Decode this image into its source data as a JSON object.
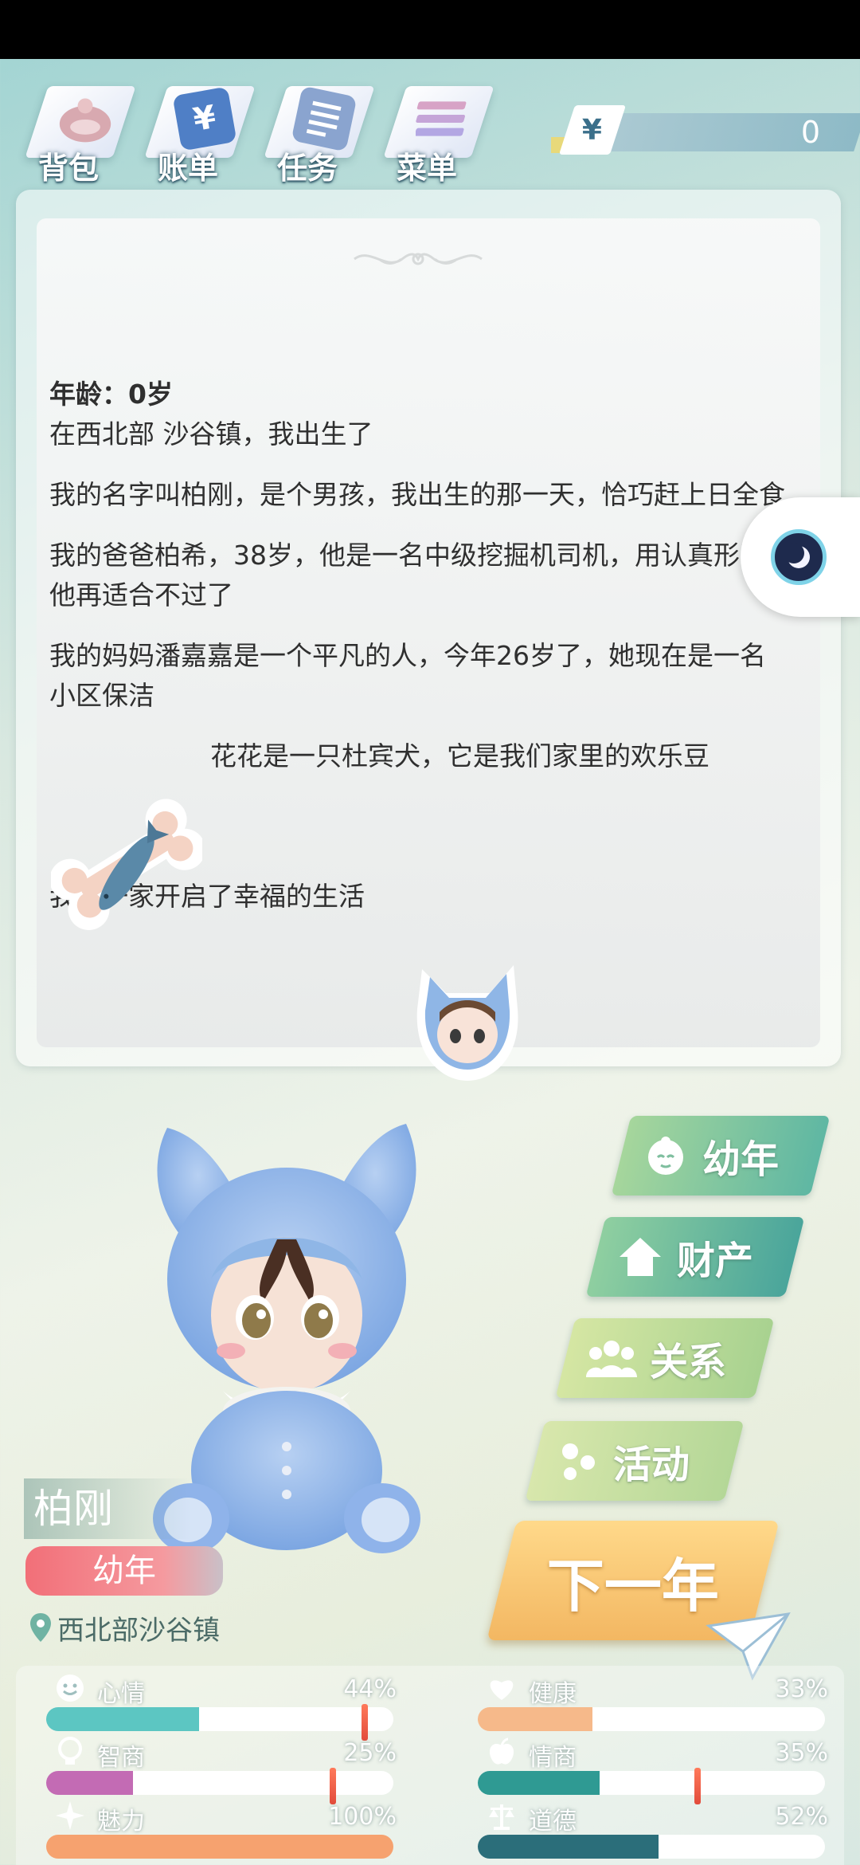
{
  "nav": {
    "items": [
      {
        "label": "背包",
        "icon": "backpack-icon"
      },
      {
        "label": "账单",
        "icon": "bill-icon"
      },
      {
        "label": "任务",
        "icon": "task-list-icon"
      },
      {
        "label": "菜单",
        "icon": "menu-icon"
      }
    ],
    "currency_symbol": "¥",
    "money": "0"
  },
  "story": {
    "age": "年龄：0岁",
    "lines": [
      "在西北部 沙谷镇，我出生了",
      "我的名字叫柏刚，是个男孩，我出生的那一天，恰巧赶上日全食",
      "我的爸爸柏希，38岁，他是一名中级挖掘机司机，用认真形容他再适合不过了",
      "我的妈妈潘嘉嘉是一个平凡的人，今年26岁了，她现在是一名小区保洁",
      "花花是一只杜宾犬，它是我们家里的欢乐豆",
      "我们一家开启了幸福的生活"
    ]
  },
  "actions": {
    "stage_label": "幼年",
    "assets_label": "财产",
    "relations_label": "关系",
    "activity_label": "活动",
    "next_year_label": "下一年"
  },
  "profile": {
    "name": "柏刚",
    "stage": "幼年",
    "location": "西北部沙谷镇"
  },
  "stats": {
    "mood": {
      "label": "心情",
      "pct": "44%",
      "value": 0.44
    },
    "health": {
      "label": "健康",
      "pct": "33%",
      "value": 0.33
    },
    "iq": {
      "label": "智商",
      "pct": "25%",
      "value": 0.25
    },
    "eq": {
      "label": "情商",
      "pct": "35%",
      "value": 0.35
    },
    "charm": {
      "label": "魅力",
      "pct": "100%",
      "value": 1.0
    },
    "morality": {
      "label": "道德",
      "pct": "52%",
      "value": 0.52
    }
  },
  "colors": {
    "mood": "#5cc6c2",
    "health": "#f6b98a",
    "iq": "#c36bb4",
    "eq": "#2f9a93",
    "charm": "#f6a26f",
    "morality": "#2b6e7a"
  }
}
